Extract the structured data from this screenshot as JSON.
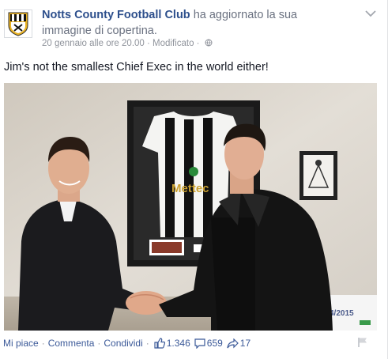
{
  "post": {
    "page_name": "Notts County Football Club",
    "action_text_1": " ha aggiornato la sua",
    "action_text_2": "immagine di copertina.",
    "timestamp": "20 gennaio alle ore 20.00",
    "separator": " · ",
    "edited": "Modificato",
    "message": "Jim's not the smallest Chief Exec in the world either!",
    "shirt_sponsor": "Mettec",
    "poster_text": "4/2015"
  },
  "actions": {
    "like": "Mi piace",
    "comment": "Commenta",
    "share": "Condividi",
    "sep": "·",
    "likes_count": "1.346",
    "comments_count": "659",
    "shares_count": "17"
  },
  "icons": {
    "options": "chevron-down-icon",
    "privacy": "globe-icon",
    "like": "thumbs-up-icon",
    "comment": "speech-bubble-icon",
    "share": "share-arrow-icon",
    "report": "flag-icon"
  },
  "colors": {
    "link_blue": "#3b5998",
    "name_blue": "#2d4f8c",
    "meta_gray": "#90949c"
  }
}
